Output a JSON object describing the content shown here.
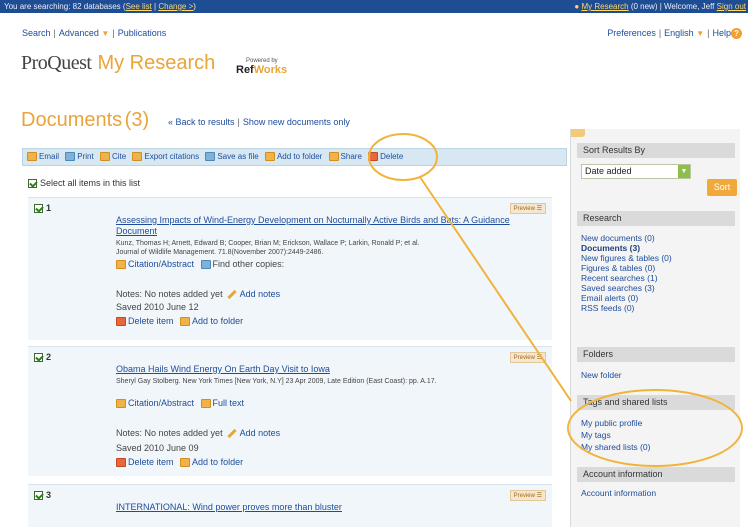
{
  "topbar": {
    "searching_prefix": "You are searching: 82 databases (",
    "see_list": "See list",
    "divider": " | ",
    "change": "Change >",
    "searching_suffix": ")",
    "my_research": "My Research",
    "my_research_count": " (0 new) | Welcome, Jeff ",
    "sign_out": "Sign out"
  },
  "nav": {
    "search": "Search",
    "advanced": "Advanced",
    "publications": "Publications",
    "preferences": "Preferences",
    "language": "English",
    "help": "Help",
    "help_icon": "?"
  },
  "brand": {
    "proquest": "ProQuest",
    "my_research": "My Research",
    "powered_by": "Powered by",
    "refworks_ref": "Ref",
    "refworks_works": "Works"
  },
  "documents": {
    "title": "Documents",
    "count": "(3)",
    "back_to_results": "« Back to results",
    "show_new": "Show new documents only"
  },
  "toolbar": {
    "email": "Email",
    "print": "Print",
    "cite": "Cite",
    "export": "Export citations",
    "save_file": "Save as file",
    "add_folder": "Add to folder",
    "share": "Share",
    "delete": "Delete"
  },
  "select_all": "Select all items in this list",
  "records": [
    {
      "num": "1",
      "preview": "Preview ☰",
      "title": "Assessing Impacts of Wind-Energy Development on Nocturnally Active Birds and Bats: A Guidance Document",
      "authors": "Kunz, Thomas H; Arnett, Edward B; Cooper, Brian M; Erickson, Wallace P; Larkin, Ronald P; et al.",
      "source": "Journal of Wildlife Management. 71.8(November 2007):2449-2486.",
      "link1": "Citation/Abstract",
      "link2": "Find other copies:",
      "notes_label": "Notes: No notes added yet",
      "add_notes": "Add notes",
      "saved": "Saved 2010 June 12",
      "delete_item": "Delete item",
      "add_to_folder": "Add to folder"
    },
    {
      "num": "2",
      "preview": "Preview ☰",
      "title": "Obama Hails Wind Energy On Earth Day Visit to Iowa",
      "authors": "Sheryl Gay Stolberg. New York Times [New York, N.Y] 23 Apr 2009, Late Edition (East Coast): pp. A.17.",
      "link1": "Citation/Abstract",
      "link2": "Full text",
      "notes_label": "Notes: No notes added yet",
      "add_notes": "Add notes",
      "saved": "Saved 2010 June 09",
      "delete_item": "Delete item",
      "add_to_folder": "Add to folder"
    },
    {
      "num": "3",
      "preview": "Preview ☰",
      "title": "INTERNATIONAL: Wind power proves more than bluster"
    }
  ],
  "sidebar": {
    "sort_heading": "Sort Results By",
    "sort_value": "Date added",
    "sort_button": "Sort",
    "research_heading": "Research",
    "research_items": [
      "New documents (0)",
      "Documents (3)",
      "New figures & tables (0)",
      "Figures & tables (0)",
      "Recent searches (1)",
      "Saved searches (3)",
      "Email alerts (0)",
      "RSS feeds (0)"
    ],
    "folders_heading": "Folders",
    "new_folder": "New folder",
    "tags_heading": "Tags and shared lists",
    "tags_items": [
      "My public profile",
      "My tags",
      "My shared lists (0)"
    ],
    "account_heading": "Account information",
    "account_link": "Account information"
  },
  "colors": {
    "accent": "#e9a43a",
    "link": "#1d4c9c",
    "topbar": "#1f4d93",
    "highlight_ring": "#f0b43c"
  }
}
